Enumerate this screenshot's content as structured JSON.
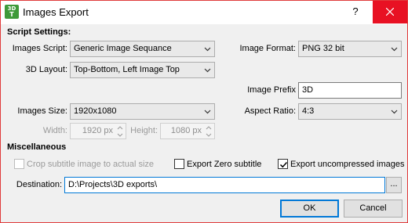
{
  "window": {
    "title": "Images Export",
    "help": "?"
  },
  "app_icon": {
    "line1": "3D",
    "line2": "T"
  },
  "script_settings": {
    "heading": "Script Settings:",
    "images_script": {
      "label": "Images Script:",
      "value": "Generic Image Sequance"
    },
    "image_format": {
      "label": "Image Format:",
      "value": "PNG 32 bit"
    },
    "layout_3d": {
      "label": "3D Layout:",
      "value": "Top-Bottom, Left Image Top"
    },
    "image_prefix": {
      "label": "Image Prefix",
      "value": "3D"
    },
    "images_size": {
      "label": "Images Size:",
      "value": "1920x1080"
    },
    "aspect_ratio": {
      "label": "Aspect Ratio:",
      "value": "4:3"
    },
    "width": {
      "label": "Width:",
      "value": "1920 px"
    },
    "height": {
      "label": "Height:",
      "value": "1080 px"
    }
  },
  "miscellaneous": {
    "heading": "Miscellaneous",
    "crop_subtitle": {
      "label": "Crop subtitle image to actual size",
      "checked": false,
      "enabled": false
    },
    "export_zero_subtitle": {
      "label": "Export Zero subtitle",
      "checked": false
    },
    "export_uncompressed": {
      "label": "Export uncompressed images",
      "checked": true
    },
    "destination": {
      "label": "Destination:",
      "value": "D:\\Projects\\3D exports\\",
      "browse": "..."
    }
  },
  "buttons": {
    "ok": "OK",
    "cancel": "Cancel"
  }
}
